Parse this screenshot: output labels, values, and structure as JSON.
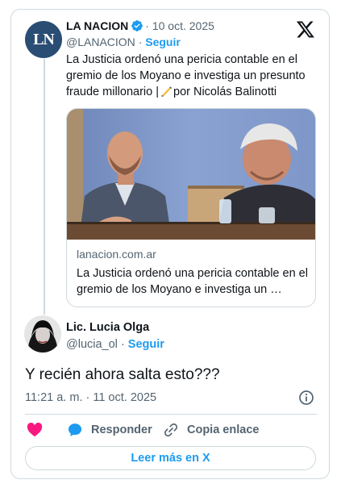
{
  "quoted_tweet": {
    "author_name": "LA NACION",
    "avatar_initials": "LN",
    "separator": "·",
    "date": "10 oct. 2025",
    "handle": "@LANACION",
    "follow_label": "Seguir",
    "text": "La Justicia ordenó una pericia contable en el gremio de los Moyano e investiga un presunto fraude millonario |",
    "text_suffix": "por Nicolás Balinotti",
    "link_card": {
      "domain": "lanacion.com.ar",
      "title": "La Justicia ordenó una pericia contable en el gremio de los Moyano e investiga un …"
    }
  },
  "reply_tweet": {
    "author_name": "Lic. Lucia Olga",
    "handle": "@lucia_ol",
    "separator": "·",
    "follow_label": "Seguir",
    "text": "Y recién ahora salta esto???",
    "timestamp": "11:21 a. m. · 11 oct. 2025"
  },
  "actions": {
    "reply_label": "Responder",
    "copy_link_label": "Copia enlace"
  },
  "read_more_label": "Leer más en X",
  "colors": {
    "accent": "#1d9bf0",
    "like": "#f91880",
    "text": "#0f1419",
    "muted": "#536471",
    "border": "#cfd9de",
    "lanacion_avatar": "#2a4d74"
  },
  "icons": [
    "x-logo-icon",
    "verified-badge-icon",
    "writing-hand-icon",
    "info-icon",
    "heart-icon",
    "reply-bubble-icon",
    "link-icon"
  ]
}
